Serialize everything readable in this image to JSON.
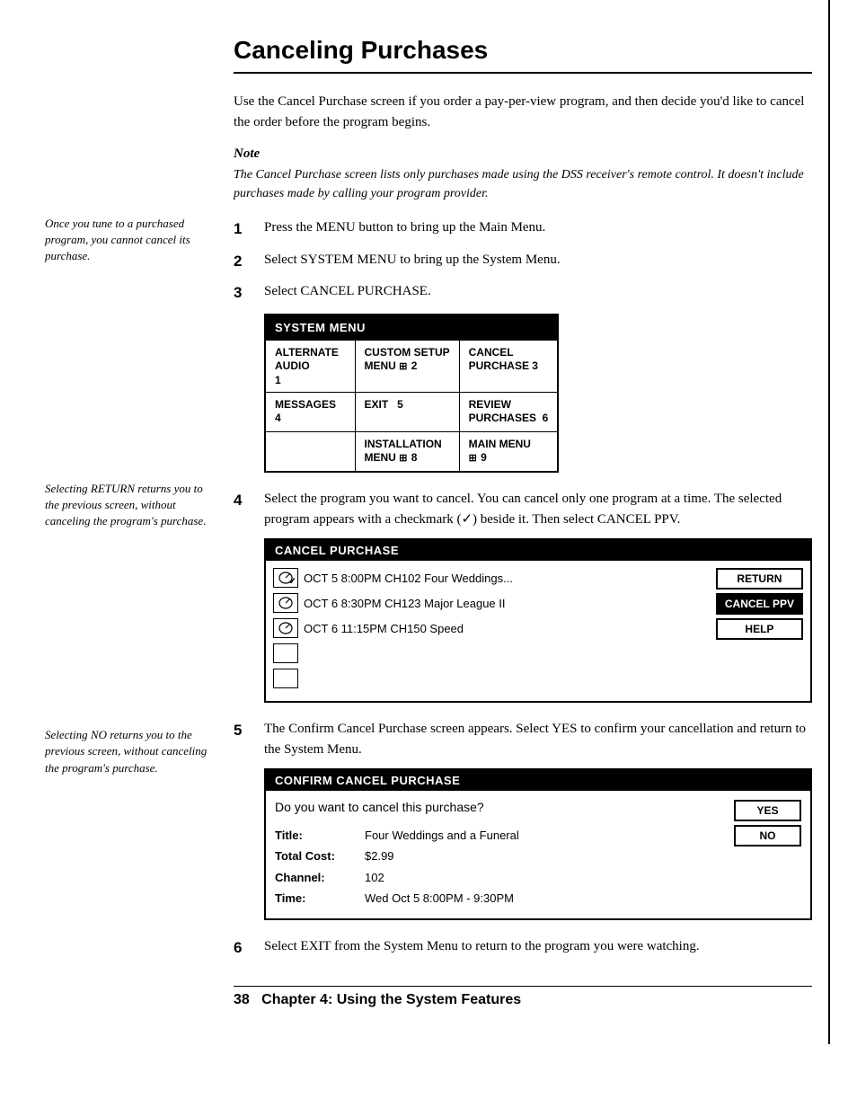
{
  "page": {
    "title": "Canceling Purchases",
    "right_border": true
  },
  "sidebar": {
    "note1": "Once you tune to a purchased program, you cannot cancel its purchase.",
    "note2": "Selecting RETURN returns you to the previous screen, without canceling the program's purchase.",
    "note3": "Selecting NO returns you to the previous screen, without canceling the program's purchase."
  },
  "intro": {
    "text": "Use the Cancel Purchase screen if you order a pay-per-view program, and then decide you'd like to cancel the order before the program begins.",
    "note_label": "Note",
    "note_text": "The Cancel Purchase screen lists only purchases made using the DSS receiver's remote control. It doesn't include purchases made by calling your program provider."
  },
  "steps": [
    {
      "num": "1",
      "text": "Press the MENU button to bring up the Main Menu."
    },
    {
      "num": "2",
      "text": "Select SYSTEM MENU to bring up the System Menu."
    },
    {
      "num": "3",
      "text": "Select CANCEL PURCHASE."
    },
    {
      "num": "4",
      "text": "Select the program you want to cancel. You can cancel only one program at a time. The selected program appears with a checkmark (✓) beside it. Then select CANCEL PPV."
    },
    {
      "num": "5",
      "text": "The Confirm Cancel Purchase screen appears. Select YES to confirm your cancellation and return to the System Menu."
    },
    {
      "num": "6",
      "text": "Select EXIT from the System Menu to return to the program you were watching."
    }
  ],
  "system_menu": {
    "title": "SYSTEM MENU",
    "items": [
      {
        "label": "ALTERNATE\nAUDIO",
        "num": "1",
        "icon": ""
      },
      {
        "label": "CUSTOM SETUP\nMENU",
        "num": "2",
        "icon": "⊞"
      },
      {
        "label": "CANCEL\nPURCHASE",
        "num": "3",
        "icon": ""
      },
      {
        "label": "MESSAGES",
        "num": "4",
        "icon": ""
      },
      {
        "label": "EXIT",
        "num": "5",
        "icon": ""
      },
      {
        "label": "REVIEW\nPURCHASES",
        "num": "6",
        "icon": ""
      },
      {
        "label": "",
        "num": "",
        "icon": ""
      },
      {
        "label": "INSTALLATION\nMENU",
        "num": "8",
        "icon": "⊞"
      },
      {
        "label": "MAIN MENU",
        "num": "9",
        "icon": "⊞"
      }
    ]
  },
  "cancel_purchase": {
    "title": "CANCEL PURCHASE",
    "programs": [
      {
        "checked": true,
        "detail": "OCT 5  8:00PM  CH102  Four Weddings..."
      },
      {
        "checked": false,
        "detail": "OCT 6  8:30PM  CH123  Major League II"
      },
      {
        "checked": false,
        "detail": "OCT 6  11:15PM CH150  Speed"
      }
    ],
    "buttons": [
      {
        "label": "RETURN",
        "highlighted": false
      },
      {
        "label": "CANCEL PPV",
        "highlighted": true
      },
      {
        "label": "HELP",
        "highlighted": false
      }
    ]
  },
  "confirm_cancel": {
    "title": "CONFIRM CANCEL PURCHASE",
    "question": "Do you want to cancel this purchase?",
    "fields": [
      {
        "label": "Title:",
        "value": "Four Weddings and a Funeral"
      },
      {
        "label": "Total Cost:",
        "value": "$2.99"
      },
      {
        "label": "Channel:",
        "value": "102"
      },
      {
        "label": "Time:",
        "value": "Wed Oct 5 8:00PM - 9:30PM"
      }
    ],
    "buttons": [
      {
        "label": "YES",
        "highlighted": false
      },
      {
        "label": "NO",
        "highlighted": false
      }
    ]
  },
  "footer": {
    "page_num": "38",
    "chapter": "Chapter 4: Using the System Features"
  }
}
